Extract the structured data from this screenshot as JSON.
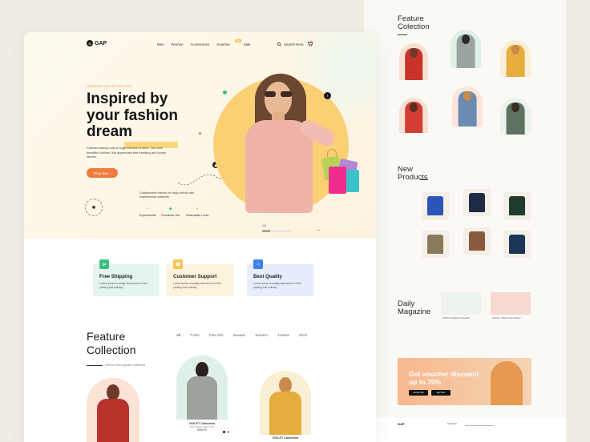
{
  "brand": {
    "name": "GAP",
    "mark": "G"
  },
  "nav": {
    "items": [
      "Men",
      "Women",
      "Accessories",
      "Summer",
      "Sale"
    ],
    "summer_badge": "New",
    "search_label": "Search Here"
  },
  "hero": {
    "eyebrow": "TRENDING COLLECTION 2022",
    "headline_line1": "Inspired by",
    "headline_line2_a": "your ",
    "headline_line2_b": "fashion",
    "headline_line3": "dream",
    "description": "Fashion always was a huge interest of mine. You love beautiful clothes. We appreciate fine beading and lovely fabrics.",
    "cta": "Shop Now",
    "collab": "Collaborative fashion for daily activity with experimental materials",
    "features": [
      "Experimental",
      "Functional Use",
      "Minimalistic Looks"
    ],
    "slide_label": "1/4"
  },
  "services": [
    {
      "title": "Free Shipping",
      "text": "Lorem Ipsum is simply dummy text of the printing and industry",
      "bg": "#e3f5ec",
      "icon_bg": "#3fbf7f",
      "icon": "paper-plane-icon"
    },
    {
      "title": "Customer Support",
      "text": "Lorem Ipsum is simply dummy text of the printing and industry",
      "bg": "#fdf3dc",
      "icon_bg": "#f6c453",
      "icon": "support-icon"
    },
    {
      "title": "Best Quality",
      "text": "Lorem Ipsum is simply dummy text of the printing and industry",
      "bg": "#e6eefc",
      "icon_bg": "#3f7ff0",
      "icon": "quality-icon"
    }
  ],
  "feature_collection": {
    "title_line1": "Feature",
    "title_line2": "Collection",
    "subtitle": "Get our best popular collection",
    "tabs": [
      "All",
      "T-shirt",
      "Polo shirt",
      "Sweater",
      "Sweater",
      "Jackets",
      "Short"
    ],
    "items": [
      {
        "name": "VIOLET Collection",
        "desc": "Pink Watch Cotton Tee",
        "price": "$18.00"
      },
      {
        "name": "VIOLET Collection",
        "desc": "",
        "price": ""
      }
    ]
  },
  "right_page": {
    "feature_title_line1": "Feature",
    "feature_title_line2": "Colection",
    "new_title_line1": "New",
    "new_title_line2": "Products",
    "magazine_title_line1": "Daily",
    "magazine_title_line2": "Magazine",
    "magazine_posts": [
      "2022Trend fashion Inspiration",
      "Fashion, \"What is Get Fashion\""
    ],
    "voucher_title": "Get voucher discount up to 70%",
    "store_buttons": [
      "Google Play",
      "App Store"
    ],
    "footer_brand": "GAP",
    "footer_newsletter": "Newsletter"
  },
  "colors": {
    "accent": "#f07b3f",
    "highlight": "#f9d77a",
    "hero_circle": "#fbcf74"
  }
}
